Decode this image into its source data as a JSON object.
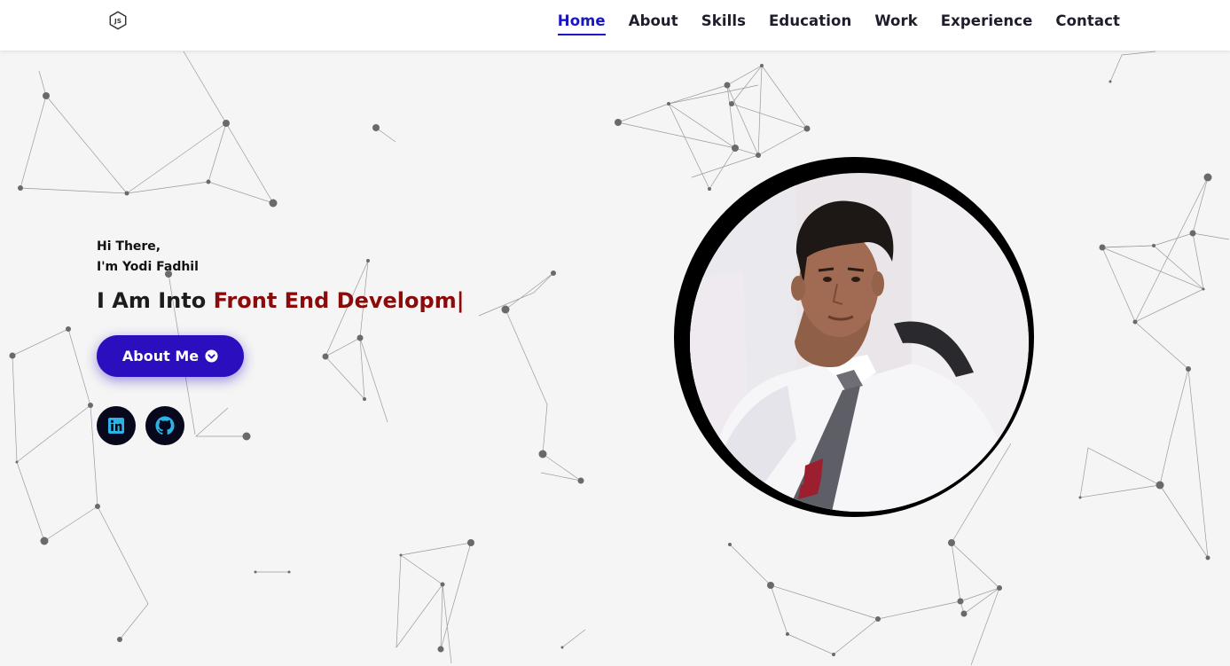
{
  "header": {
    "logo_icon": "nodejs-icon",
    "nav": [
      {
        "label": "Home",
        "active": true
      },
      {
        "label": "About",
        "active": false
      },
      {
        "label": "Skills",
        "active": false
      },
      {
        "label": "Education",
        "active": false
      },
      {
        "label": "Work",
        "active": false
      },
      {
        "label": "Experience",
        "active": false
      },
      {
        "label": "Contact",
        "active": false
      }
    ]
  },
  "hero": {
    "greeting_line1": "Hi There,",
    "greeting_line2": "I'm Yodi Fadhil",
    "role_prefix": "I Am Into",
    "role_typed": "Front End Developm|",
    "button_label": "About Me",
    "button_icon": "chevron-circle-down-icon",
    "social": [
      {
        "icon": "linkedin-icon"
      },
      {
        "icon": "github-icon"
      }
    ]
  },
  "profile_photo": {
    "subject": "man in white shirt and grey tie"
  },
  "colors": {
    "accent": "#1a16c4",
    "button": "#2b0fbf",
    "typed_text": "#8b0b0b",
    "background": "#f5f5f5",
    "social_bg": "#08081c",
    "linkedin": "#2bb3e6"
  }
}
